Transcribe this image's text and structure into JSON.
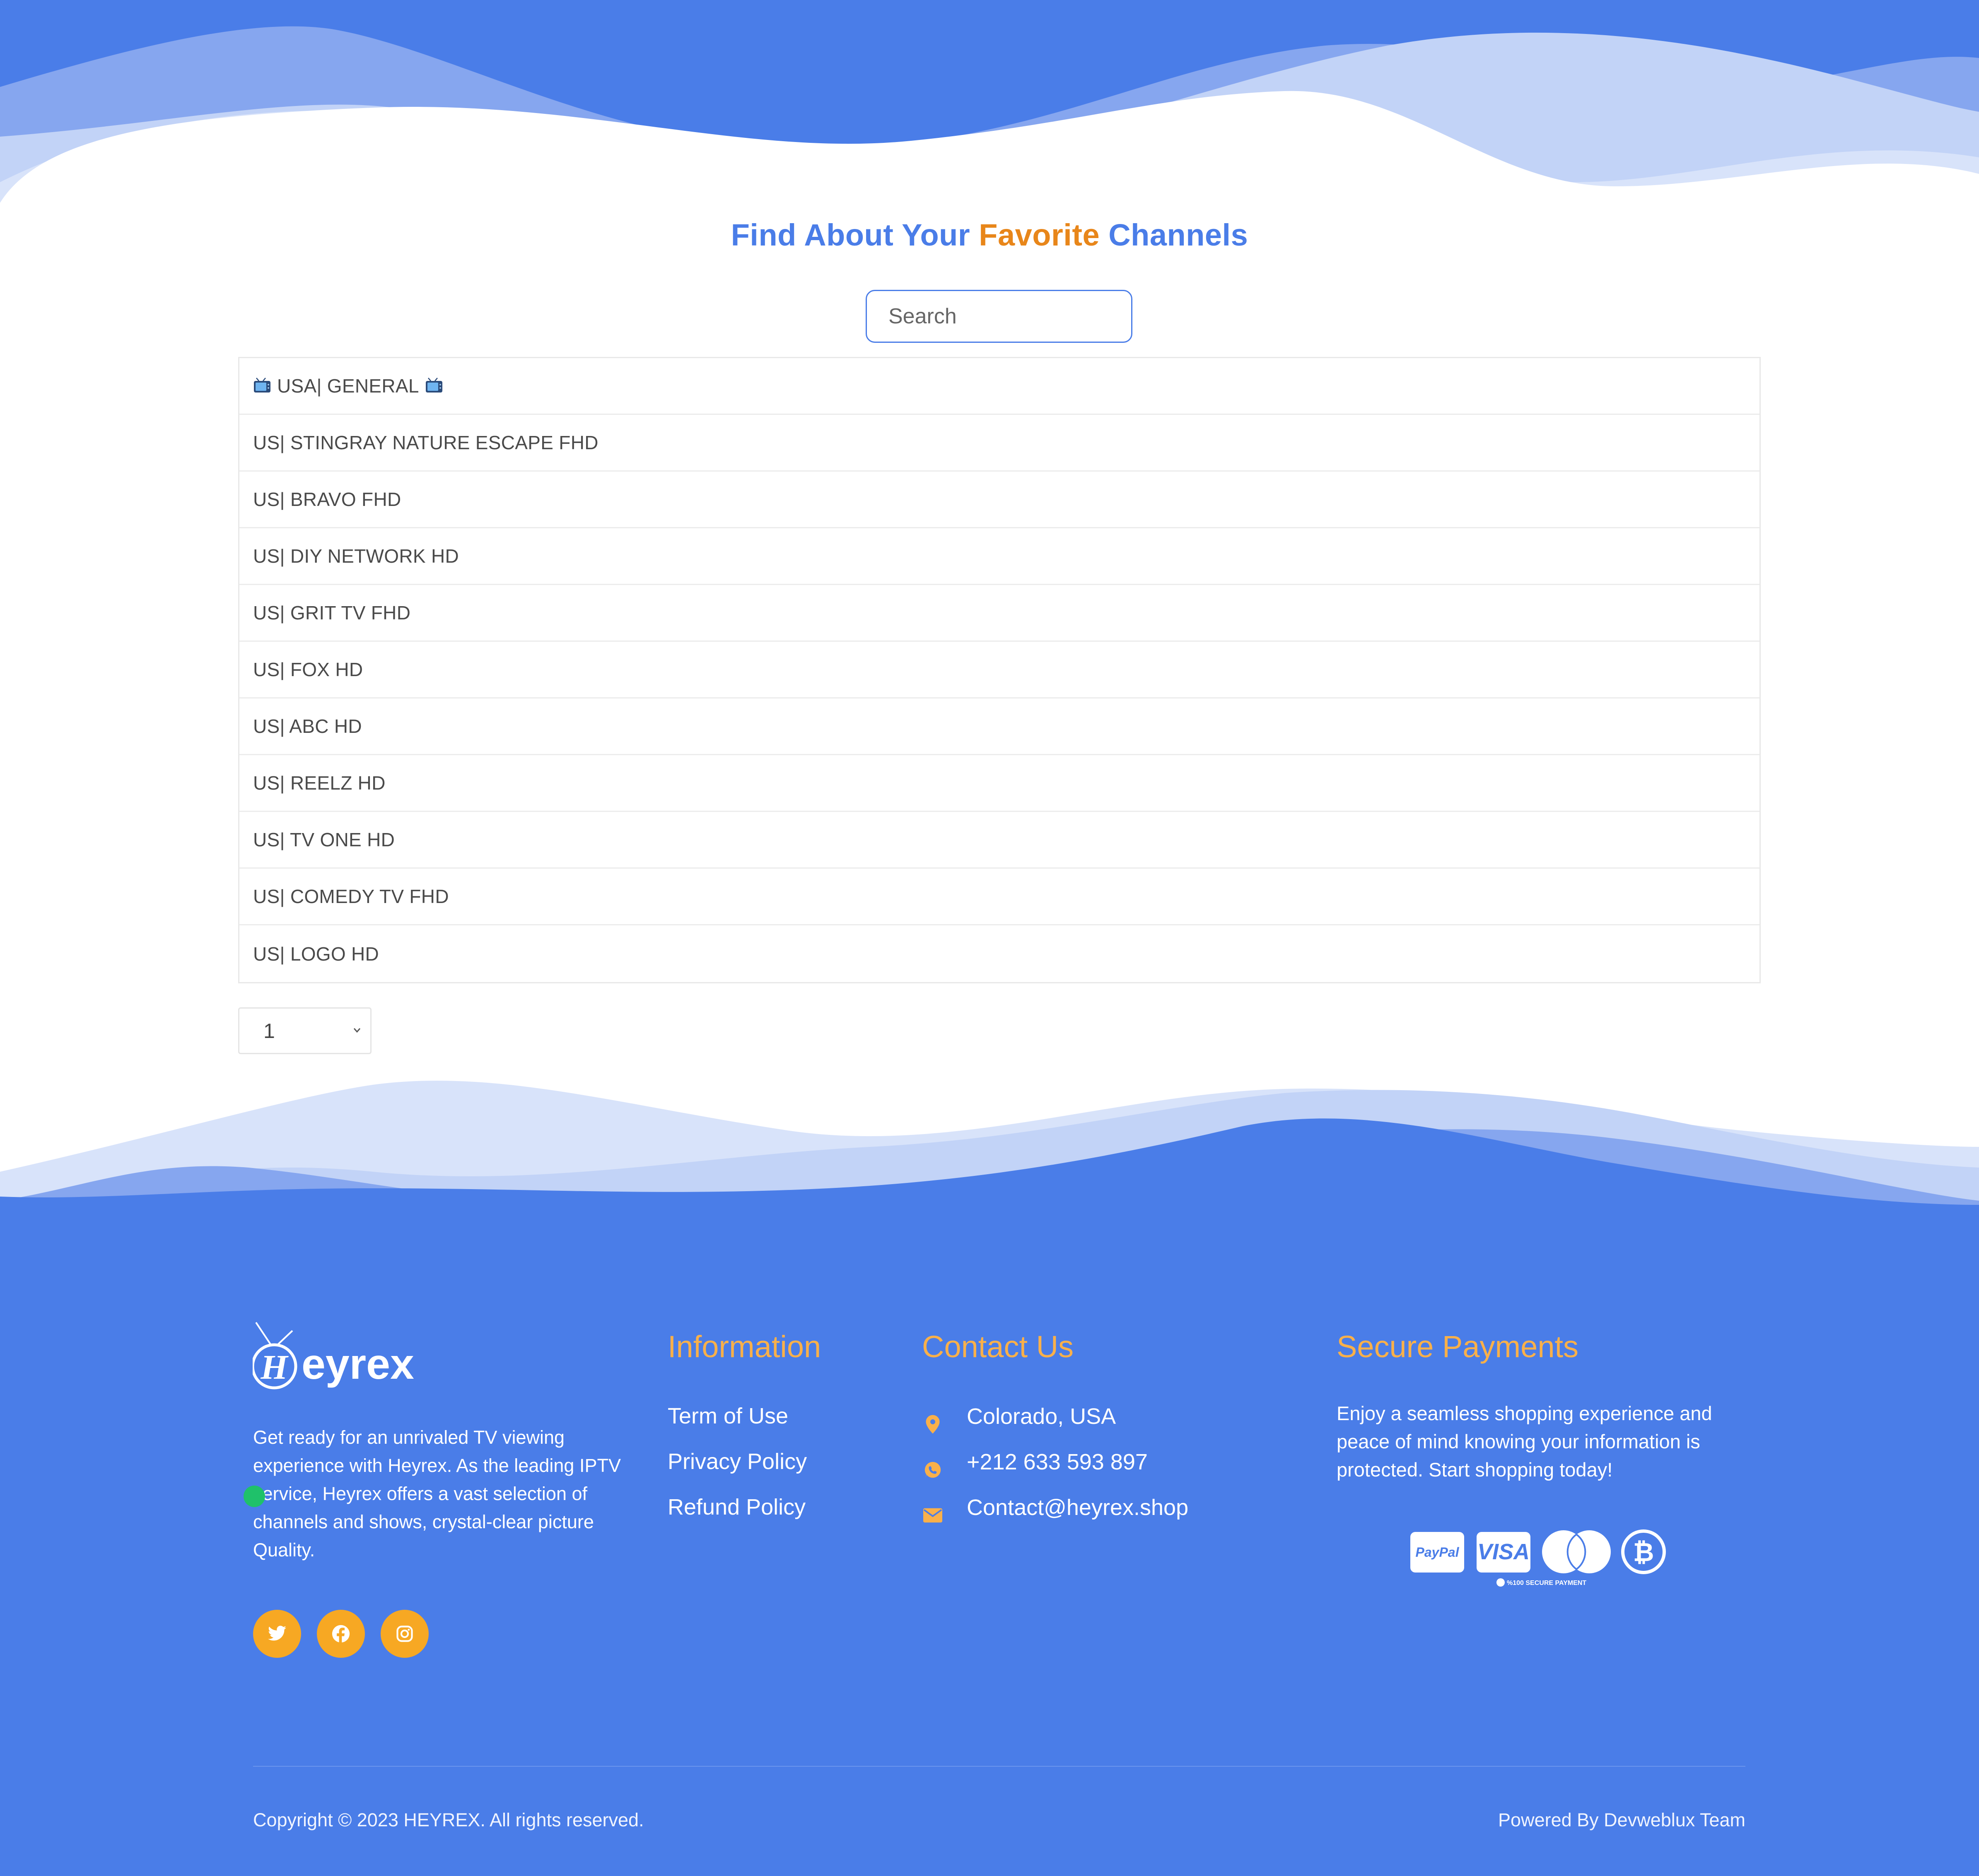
{
  "colors": {
    "brand_blue": "#4a7de8",
    "accent_orange": "#e8861a",
    "footer_heading": "#f9b04a",
    "social_bg": "#f7a823"
  },
  "header": {
    "title_part1": "Find About Your",
    "title_accent": "Favorite",
    "title_part2": "Channels"
  },
  "search": {
    "placeholder": "Search",
    "value": ""
  },
  "channels": [
    {
      "label": "USA| GENERAL",
      "icon": "tv-icon"
    },
    {
      "label": "US| STINGRAY NATURE ESCAPE FHD"
    },
    {
      "label": "US| BRAVO FHD"
    },
    {
      "label": "US| DIY NETWORK HD"
    },
    {
      "label": "US| GRIT TV FHD"
    },
    {
      "label": "US| FOX HD"
    },
    {
      "label": "US| ABC HD"
    },
    {
      "label": "US| REELZ HD"
    },
    {
      "label": "US| TV ONE HD"
    },
    {
      "label": "US| COMEDY TV FHD"
    },
    {
      "label": "US| LOGO HD"
    }
  ],
  "pagination": {
    "selected": "1"
  },
  "footer": {
    "logo_text": "eyrex",
    "logo_letter": "H",
    "about": "Get ready for an unrivaled TV viewing experience with Heyrex. As the leading IPTV service, Heyrex offers a vast selection of channels and shows, crystal-clear picture Quality.",
    "social": [
      "twitter-icon",
      "facebook-icon",
      "instagram-icon"
    ],
    "information": {
      "heading": "Information",
      "links": [
        "Term of Use",
        "Privacy Policy",
        "Refund Policy"
      ]
    },
    "contact": {
      "heading": "Contact Us",
      "location": "Colorado, USA",
      "phone": "+212 633 593 897",
      "email": "Contact@heyrex.shop"
    },
    "payments": {
      "heading": "Secure Payments",
      "text": "Enjoy a seamless shopping experience and peace of mind knowing your information is protected. Start shopping today!",
      "paypal": "PayPal",
      "visa": "VISA",
      "badge": "%100 SECURE PAYMENT"
    },
    "copyright": "Copyright © 2023 HEYREX. All rights reserved.",
    "powered_by": "Powered By Devweblux Team"
  }
}
